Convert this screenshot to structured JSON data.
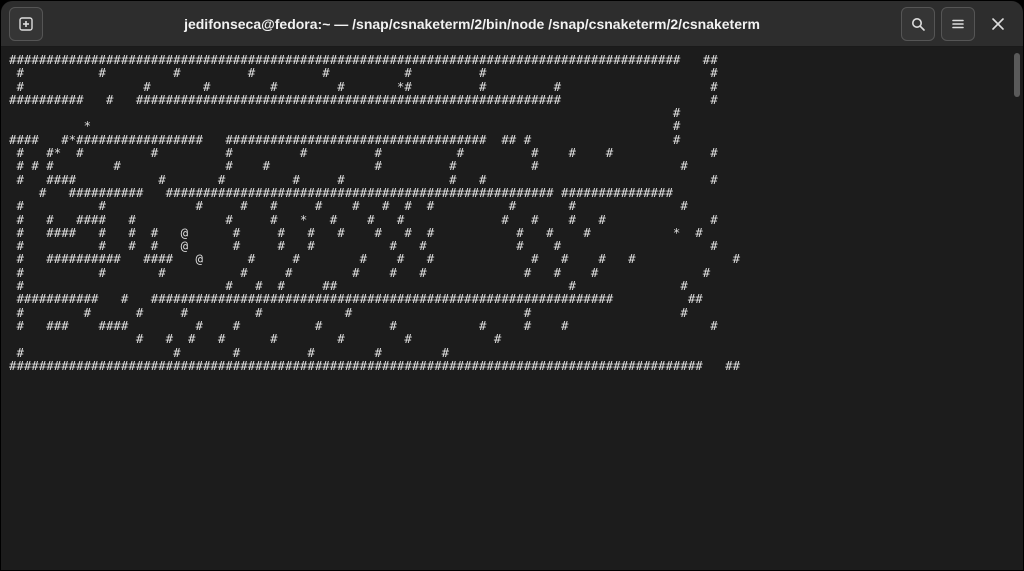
{
  "titlebar": {
    "title": "jedifonseca@fedora:~ — /snap/csnaketerm/2/bin/node /snap/csnaketerm/2/csnaketerm"
  },
  "terminal": {
    "lines": [
      "##########################################################################################   ##",
      " #          #         #         #         #          #         #                              #",
      " #                #       #        #        #       *#         #         #                    #",
      "##########   #   #########################################################                    #",
      "                                                                                         #",
      "          *                                                                              #",
      "####   #*#################   ###################################  ## #                   #",
      " #   #*  #         #         #         #         #          #         #    #    #             #",
      " # # #        #              #    #              #         #          #                   #",
      " #   ####           #       #         #     #              #   #                              #",
      "    #   ##########   #################################################### ###############",
      " #          #            #     #   #     #    #   #  #  #          #       #              #",
      " #   #   ####   #            #     #   *   #    #   #             #   #    #   #              #",
      " #   ####   #   #  #   @      #     #   #   #    #   #  #           #   #    #           *  #",
      " #          #   #  #   @      #     #   #          #   #            #    #                    #",
      " #   ##########   ####   @      #     #        #    #   #             #   #    #   #             #",
      " #          #       #          #     #        #    #   #             #   #    #              #",
      " #                           #   #  #     ##                               #              #",
      " ###########   #   ##############################################################          ##",
      " #        #      #     #         #           #                       #                    #",
      " #   ###    ####         #    #          #         #           #     #    #                   #",
      "                 #   #  #   #      #        #        #           #",
      " #                    #       #         #        #        #",
      "#############################################################################################   ##"
    ]
  }
}
